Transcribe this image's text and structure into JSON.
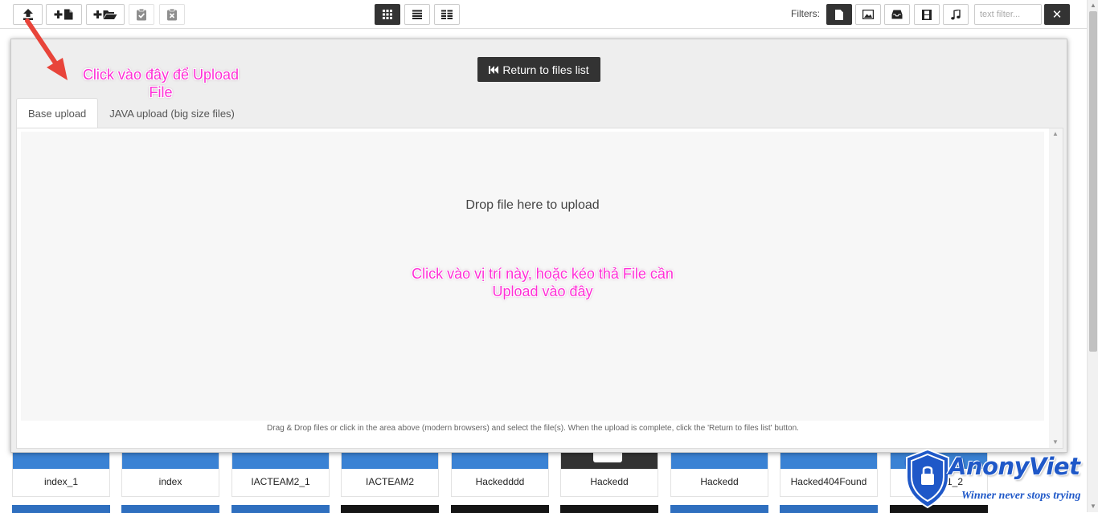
{
  "toolbar": {
    "upload_icon": "upload-icon",
    "new_file_icon": "plus-file-icon",
    "new_folder_icon": "plus-folder-icon",
    "select_icon": "clipboard-check-icon",
    "delete_icon": "clipboard-x-icon",
    "view_modes": [
      "grid-view-icon",
      "list-view-icon",
      "details-view-icon"
    ],
    "filters_label": "Filters:",
    "filter_icons": [
      "file-icon",
      "image-icon",
      "archive-icon",
      "video-icon",
      "music-icon"
    ],
    "text_filter_placeholder": "text filter..."
  },
  "upload_panel": {
    "return_button": "Return to files list",
    "tabs": [
      "Base upload",
      "JAVA upload (big size files)"
    ],
    "active_tab": 0,
    "drop_text": "Drop file here to upload",
    "help_text": "Drag & Drop files or click in the area above (modern browsers) and select the file(s). When the upload is complete, click the 'Return to files list' button."
  },
  "annotations": {
    "upload_hint": "Click vào đây để Upload File",
    "drop_hint": "Click vào vị trí này, hoặc kéo thả File cần Upload vào đây"
  },
  "files": [
    {
      "name": "index_1",
      "style": "blue"
    },
    {
      "name": "index",
      "style": "blue"
    },
    {
      "name": "IACTEAM2_1",
      "style": "blue"
    },
    {
      "name": "IACTEAM2",
      "style": "blue"
    },
    {
      "name": "Hackedddd",
      "style": "blue"
    },
    {
      "name": "Hackedd",
      "style": "dark"
    },
    {
      "name": "Hackedd",
      "style": "blue"
    },
    {
      "name": "Hacked404Found",
      "style": "blue"
    },
    {
      "name": "1_2",
      "style": "blue"
    }
  ],
  "files_row2": [
    "blue",
    "blue",
    "blue",
    "dark",
    "dark",
    "dark",
    "blue",
    "blue",
    "dark"
  ],
  "watermark": {
    "brand": "AnonyViet",
    "slogan": "Winner never stops trying"
  },
  "colors": {
    "accent_blue": "#3a82d4",
    "dark_button": "#333333",
    "annotation_pink": "#ff2fd6"
  }
}
